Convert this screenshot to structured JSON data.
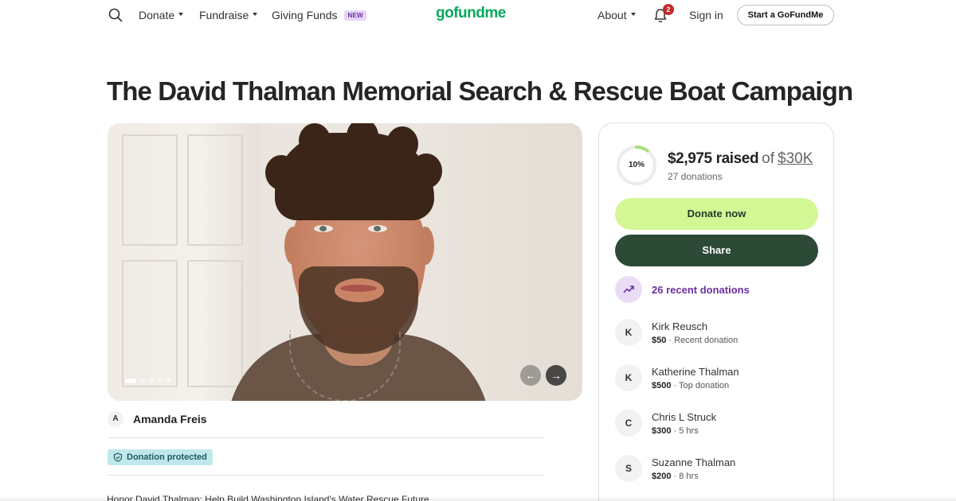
{
  "nav": {
    "donate": "Donate",
    "fundraise": "Fundraise",
    "giving_funds": "Giving Funds",
    "new_badge": "NEW",
    "logo": "gofundme",
    "about": "About",
    "notification_count": "2",
    "sign_in": "Sign in",
    "start_button": "Start a GoFundMe"
  },
  "campaign": {
    "title": "The David Thalman Memorial Search & Rescue Boat Campaign",
    "organizer_initial": "A",
    "organizer_name": "Amanda Freis",
    "protected_label": "Donation protected",
    "story_heading": "Honor David Thalman: Help Build Washington Island's Water Rescue Future"
  },
  "gallery": {
    "slide_count": 5,
    "active_slide": 1
  },
  "donations": {
    "progress_label": "10%",
    "progress_fraction": 0.1,
    "raised": "$2,975 raised",
    "of": "of",
    "goal": "$30K",
    "count_text": "27 donations",
    "donate_button": "Donate now",
    "share_button": "Share",
    "recent_label": "26 recent donations",
    "donors": [
      {
        "initial": "K",
        "name": "Kirk Reusch",
        "amount": "$50",
        "note": " · Recent donation"
      },
      {
        "initial": "K",
        "name": "Katherine Thalman",
        "amount": "$500",
        "note": " · Top donation"
      },
      {
        "initial": "C",
        "name": "Chris L Struck",
        "amount": "$300",
        "note": " · 5 hrs"
      },
      {
        "initial": "S",
        "name": "Suzanne Thalman",
        "amount": "$200",
        "note": " · 8 hrs"
      }
    ]
  },
  "colors": {
    "brand_green": "#02a95c",
    "donate_bg": "#d4f796",
    "share_bg": "#2d4a37",
    "purple_accent": "#6b2fa0",
    "progress_light": "#a7e07a"
  }
}
